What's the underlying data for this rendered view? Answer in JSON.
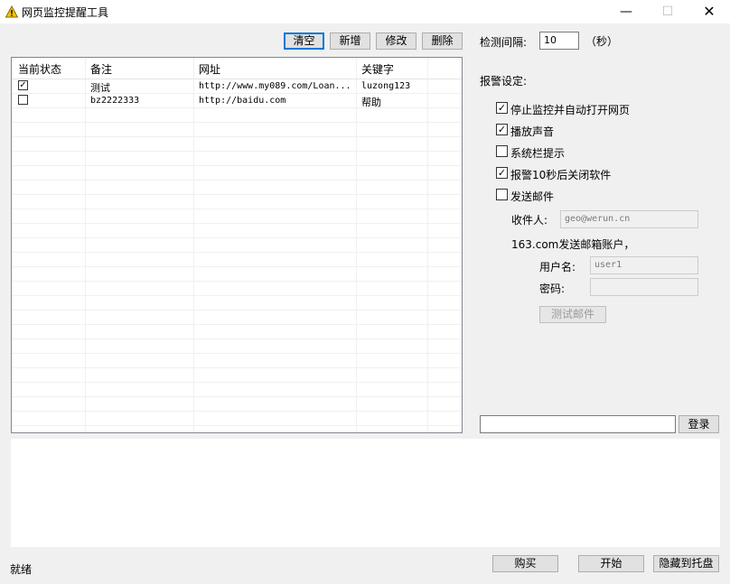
{
  "window": {
    "title": "网页监控提醒工具",
    "minimize": "—",
    "maximize": "☐",
    "close": "✕"
  },
  "toolbar": {
    "clear": "清空",
    "add": "新增",
    "edit": "修改",
    "delete": "删除"
  },
  "interval": {
    "label": "检测间隔:",
    "value": "10",
    "unit": "（秒）"
  },
  "list": {
    "headers": [
      "当前状态",
      "备注",
      "网址",
      "关键字"
    ],
    "rows": [
      {
        "checked": "✓",
        "note": "测试",
        "url": "http://www.my089.com/Loan...",
        "keyword": "luzong123"
      },
      {
        "checked": "",
        "note": "bz2222333",
        "url": "http://baidu.com",
        "keyword": "帮助"
      }
    ]
  },
  "alarm": {
    "title": "报警设定:",
    "options": [
      {
        "label": "停止监控并自动打开网页",
        "checked": "✓"
      },
      {
        "label": "播放声音",
        "checked": "✓"
      },
      {
        "label": "系统栏提示",
        "checked": ""
      },
      {
        "label": "报警10秒后关闭软件",
        "checked": "✓"
      },
      {
        "label": "发送邮件",
        "checked": ""
      }
    ],
    "recipient_label": "收件人:",
    "recipient_value": "geo@werun.cn",
    "account_title": "163.com发送邮箱账户，",
    "username_label": "用户名:",
    "username_value": "user1",
    "password_label": "密码:",
    "password_value": "",
    "test_mail": "测试邮件"
  },
  "login": {
    "input_value": "",
    "button": "登录"
  },
  "log": {
    "text": ""
  },
  "status": {
    "text": "就绪"
  },
  "footer": {
    "buy": "购买",
    "start": "开始",
    "hide_tray": "隐藏到托盘"
  },
  "colors": {
    "accent": "#0078d7",
    "window_bg": "#f0f0f0"
  }
}
